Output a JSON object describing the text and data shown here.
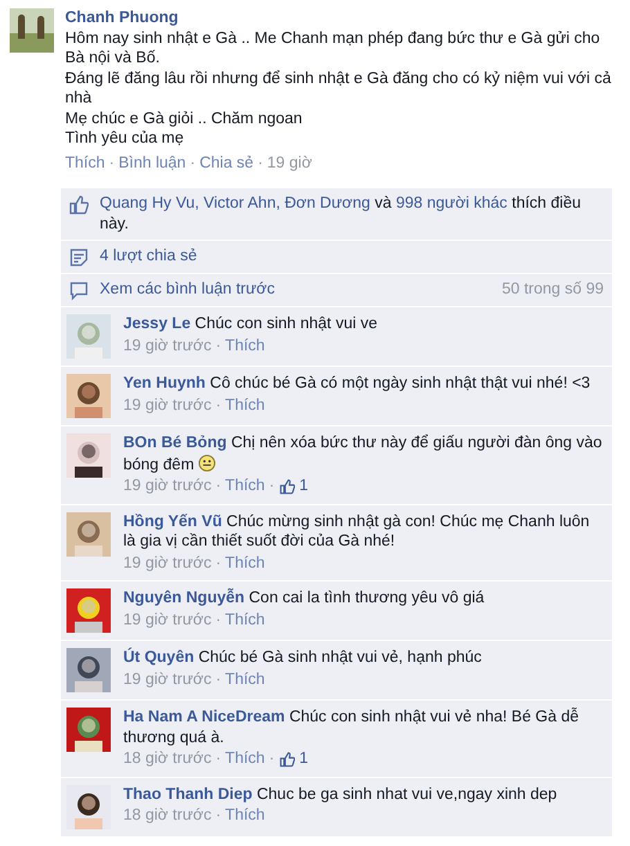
{
  "separator": "·",
  "post": {
    "author": "Chanh Phuong",
    "lines": [
      "Hôm nay sinh nhật e Gà .. Me Chanh mạn phép đang bức thư e Gà gửi cho Bà nội và Bố.",
      "Đáng lẽ đăng lâu rồi nhưng để sinh nhật e Gà đăng cho có kỷ niệm vui với cả nhà",
      "Mẹ chúc e Gà giỏi .. Chăm ngoan",
      "Tình yêu của mẹ"
    ],
    "actions": [
      {
        "label": "Thích",
        "kind": "link"
      },
      {
        "label": "Bình luận",
        "kind": "link"
      },
      {
        "label": "Chia sẻ",
        "kind": "link"
      },
      {
        "label": "19 giờ",
        "kind": "time"
      }
    ]
  },
  "likes": [
    {
      "text": "Quang Hy Vu, Victor Ahn, Đơn Dương",
      "link": true
    },
    {
      "text": "và",
      "link": false
    },
    {
      "text": "998 người khác",
      "link": true
    },
    {
      "text": "thích điều này.",
      "link": false
    }
  ],
  "shares": "4 lượt chia sẻ",
  "more_comments": {
    "label": "Xem các bình luận trước",
    "count": "50 trong số 99"
  },
  "comments": [
    {
      "name": "Jessy Le",
      "text": "Chúc con sinh nhật vui ve",
      "time": "19 giờ trước",
      "like": "Thích"
    },
    {
      "name": "Yen Huynh",
      "text": "Cô chúc bé Gà có một ngày sinh nhật thật vui nhé! <3",
      "time": "19 giờ trước",
      "like": "Thích"
    },
    {
      "name": "BOn Bé Bỏng",
      "text": "Chị nên xóa bức thư này để giấu người đàn ông vào bóng đêm",
      "smiley": true,
      "time": "19 giờ trước",
      "like": "Thích",
      "like_count": "1"
    },
    {
      "name": "Hồng Yến Vũ",
      "text": "Chúc mừng sinh nhật gà con! Chúc mẹ Chanh luôn là gia vị cần thiết suốt đời của Gà nhé!",
      "time": "19 giờ trước",
      "like": "Thích"
    },
    {
      "name": "Nguyên Nguyễn",
      "text": "Con cai la tình thương yêu vô giá",
      "time": "19 giờ trước",
      "like": "Thích"
    },
    {
      "name": "Út Quyên",
      "text": "Chúc bé Gà sinh nhật vui vẻ, hạnh phúc",
      "time": "19 giờ trước",
      "like": "Thích"
    },
    {
      "name": "Ha Nam A NiceDream",
      "text": "Chúc con sinh nhật vui vẻ nha! Bé Gà dễ thương quá à.",
      "time": "18 giờ trước",
      "like": "Thích",
      "like_count": "1"
    },
    {
      "name": "Thao Thanh Diep",
      "text": "Chuc be ga sinh nhat vui ve,ngay xinh dep",
      "time": "18 giờ trước",
      "like": "Thích"
    }
  ]
}
